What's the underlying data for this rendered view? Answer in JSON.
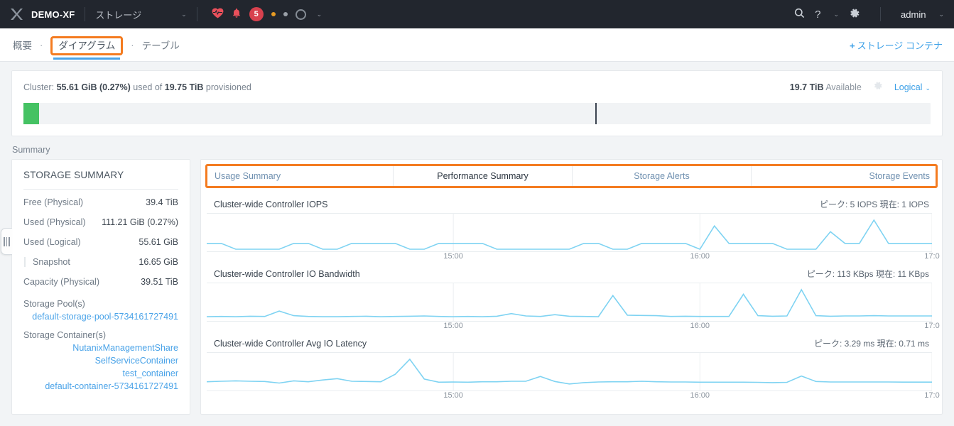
{
  "header": {
    "logo_icon": "nutanix-x-logo",
    "brand": "DEMO-XF",
    "entity": "ストレージ",
    "entity_caret": "⌄",
    "health_icon": "heart-pulse-icon",
    "bell_icon": "bell-icon",
    "alert_count": "5",
    "task_ring_icon": "task-ring-icon",
    "task_caret": "⌄",
    "search_icon": "search-icon",
    "help_icon": "help-question-icon",
    "help_caret": "⌄",
    "settings_icon": "gear-icon",
    "user": "admin",
    "user_caret": "⌄"
  },
  "subnav": {
    "crumbs": [
      {
        "label": "概要",
        "active": false
      },
      {
        "label": "ダイアグラム",
        "active": true
      },
      {
        "label": "テーブル",
        "active": false
      }
    ],
    "separator": "·",
    "add_plus": "+",
    "add_label": "ストレージ コンテナ"
  },
  "cluster": {
    "prefix": "Cluster:",
    "used": "55.61 GiB (0.27%)",
    "middle": "used of",
    "provisioned": "19.75 TiB",
    "suffix": "provisioned",
    "available_value": "19.7 TiB",
    "available_label": "Available",
    "gear_icon": "gear-icon",
    "view_mode": "Logical",
    "view_caret": "⌄",
    "bar_used_percent": 1.7,
    "bar_marker_percent": 63
  },
  "summary_label": "Summary",
  "storage_summary": {
    "title": "STORAGE SUMMARY",
    "rows": [
      {
        "key": "Free (Physical)",
        "value": "39.4 TiB",
        "indent": false
      },
      {
        "key": "Used (Physical)",
        "value": "111.21 GiB (0.27%)",
        "indent": false
      },
      {
        "key": "Used (Logical)",
        "value": "55.61 GiB",
        "indent": false
      },
      {
        "key": "Snapshot",
        "value": "16.65 GiB",
        "indent": true
      },
      {
        "key": "Capacity (Physical)",
        "value": "39.51 TiB",
        "indent": false
      }
    ],
    "pools_label": "Storage Pool(s)",
    "pools": [
      "default-storage-pool-5734161727491"
    ],
    "containers_label": "Storage Container(s)",
    "containers": [
      "NutanixManagementShare",
      "SelfServiceContainer",
      "test_container",
      "default-container-5734161727491"
    ]
  },
  "tabs": [
    {
      "label": "Usage Summary",
      "active": false
    },
    {
      "label": "Performance Summary",
      "active": true
    },
    {
      "label": "Storage Alerts",
      "active": false
    },
    {
      "label": "Storage Events",
      "active": false
    }
  ],
  "chart_data": [
    {
      "type": "line",
      "title": "Cluster-wide Controller IOPS",
      "peak_label": "ピーク: 5 IOPS",
      "current_label": "現在: 1 IOPS",
      "xlabel": "",
      "ylabel": "IOPS",
      "ylim": [
        0,
        5
      ],
      "grid": true,
      "xticks": [
        "15:00",
        "16:00",
        "17:0"
      ],
      "xtick_positions": [
        34,
        68,
        100
      ],
      "line_color": "#7fd3f2",
      "x": [
        0,
        2,
        4,
        6,
        8,
        10,
        12,
        14,
        16,
        18,
        20,
        22,
        24,
        26,
        28,
        30,
        32,
        34,
        36,
        38,
        40,
        42,
        44,
        46,
        48,
        50,
        52,
        54,
        56,
        58,
        60,
        62,
        64,
        66,
        68,
        70,
        72,
        74,
        76,
        78,
        80,
        82,
        84,
        86,
        88,
        90,
        92,
        94,
        96,
        98,
        100
      ],
      "values": [
        1,
        1,
        0,
        0,
        0,
        0,
        1,
        1,
        0,
        0,
        1,
        1,
        1,
        1,
        0,
        0,
        1,
        1,
        1,
        1,
        0,
        0,
        0,
        0,
        0,
        0,
        1,
        1,
        0,
        0,
        1,
        1,
        1,
        1,
        0,
        4,
        1,
        1,
        1,
        1,
        0,
        0,
        0,
        3,
        1,
        1,
        5,
        1,
        1,
        1,
        1
      ]
    },
    {
      "type": "line",
      "title": "Cluster-wide Controller IO Bandwidth",
      "peak_label": "ピーク: 113 KBps",
      "current_label": "現在: 11 KBps",
      "xlabel": "",
      "ylabel": "KBps",
      "ylim": [
        0,
        113
      ],
      "grid": true,
      "xticks": [
        "15:00",
        "16:00",
        "17:0"
      ],
      "xtick_positions": [
        34,
        68,
        100
      ],
      "line_color": "#7fd3f2",
      "x": [
        0,
        2,
        4,
        6,
        8,
        10,
        12,
        14,
        16,
        18,
        20,
        22,
        24,
        26,
        28,
        30,
        32,
        34,
        36,
        38,
        40,
        42,
        44,
        46,
        48,
        50,
        52,
        54,
        56,
        58,
        60,
        62,
        64,
        66,
        68,
        70,
        72,
        74,
        76,
        78,
        80,
        82,
        84,
        86,
        88,
        90,
        92,
        94,
        96,
        98,
        100
      ],
      "values": [
        8,
        9,
        8,
        10,
        9,
        30,
        12,
        9,
        8,
        8,
        9,
        10,
        8,
        9,
        10,
        11,
        9,
        8,
        9,
        8,
        10,
        20,
        11,
        9,
        16,
        10,
        9,
        8,
        90,
        14,
        13,
        12,
        9,
        10,
        9,
        9,
        9,
        95,
        12,
        10,
        11,
        113,
        12,
        10,
        11,
        11,
        12,
        11,
        11,
        11,
        11
      ]
    },
    {
      "type": "line",
      "title": "Cluster-wide Controller Avg IO Latency",
      "peak_label": "ピーク: 3.29 ms",
      "current_label": "現在: 0.71 ms",
      "xlabel": "",
      "ylabel": "ms",
      "ylim": [
        0,
        3.29
      ],
      "grid": true,
      "xticks": [
        "15:00",
        "16:00",
        "17:0"
      ],
      "xtick_positions": [
        34,
        68,
        100
      ],
      "line_color": "#7fd3f2",
      "x": [
        0,
        2,
        4,
        6,
        8,
        10,
        12,
        14,
        16,
        18,
        20,
        22,
        24,
        26,
        28,
        30,
        32,
        34,
        36,
        38,
        40,
        42,
        44,
        46,
        48,
        50,
        52,
        54,
        56,
        58,
        60,
        62,
        64,
        66,
        68,
        70,
        72,
        74,
        76,
        78,
        80,
        82,
        84,
        86,
        88,
        90,
        92,
        94,
        96,
        98,
        100
      ],
      "values": [
        0.75,
        0.8,
        0.85,
        0.8,
        0.78,
        0.6,
        0.85,
        0.75,
        0.95,
        1.1,
        0.8,
        0.78,
        0.75,
        1.6,
        3.29,
        1.05,
        0.7,
        0.72,
        0.7,
        0.75,
        0.75,
        0.8,
        0.8,
        1.35,
        0.78,
        0.5,
        0.65,
        0.72,
        0.75,
        0.75,
        0.8,
        0.75,
        0.72,
        0.72,
        0.7,
        0.7,
        0.7,
        0.7,
        0.68,
        0.65,
        0.68,
        1.4,
        0.78,
        0.72,
        0.72,
        0.72,
        0.72,
        0.72,
        0.71,
        0.71,
        0.71
      ]
    }
  ]
}
